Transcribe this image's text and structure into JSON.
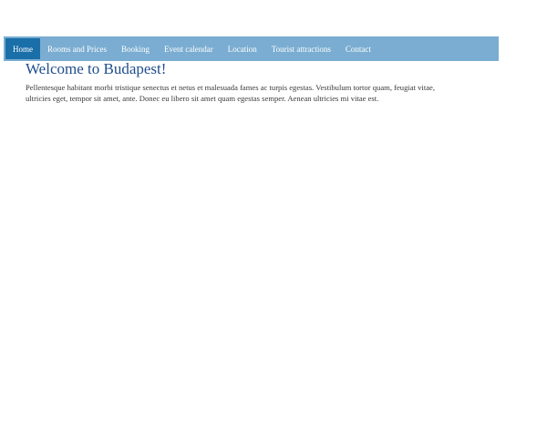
{
  "nav": {
    "items": [
      {
        "label": "Home",
        "active": true
      },
      {
        "label": "Rooms and Prices",
        "active": false
      },
      {
        "label": "Booking",
        "active": false
      },
      {
        "label": "Event calendar",
        "active": false
      },
      {
        "label": "Location",
        "active": false
      },
      {
        "label": "Tourist attractions",
        "active": false
      },
      {
        "label": "Contact",
        "active": false
      }
    ]
  },
  "main": {
    "title": "Welcome to Budapest!",
    "intro": "Pellentesque habitant morbi tristique senectus et netus et malesuada fames ac turpis egestas. Vestibulum tortor quam, feugiat vitae, ultricies eget, tempor sit amet, ante. Donec eu libero sit amet quam egestas semper. Aenean ultricies mi vitae est."
  },
  "colors": {
    "nav_background": "#7aadd1",
    "nav_active": "#1a6fa8",
    "title": "#1f4e8c"
  }
}
